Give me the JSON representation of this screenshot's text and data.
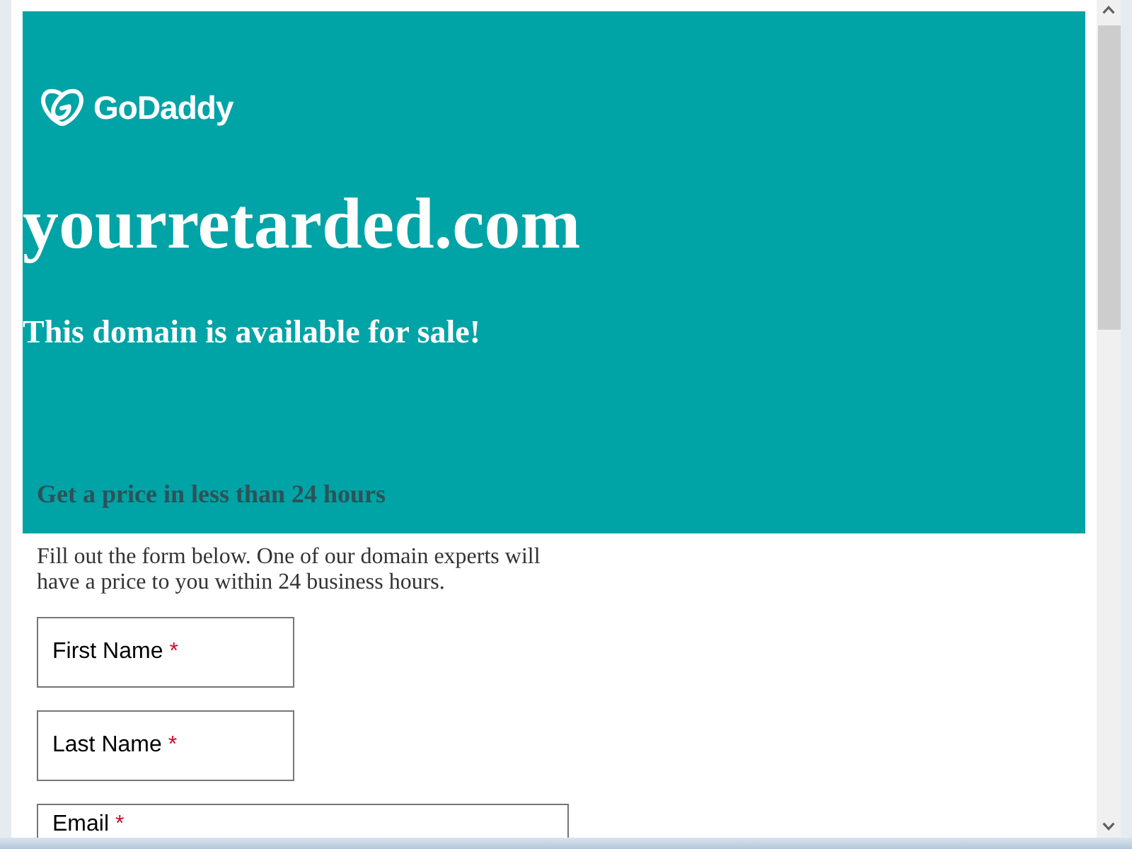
{
  "header": {
    "logo_text": "GoDaddy",
    "domain": "yourretarded.com",
    "tagline": "This domain is available for sale!",
    "subheading": "Get a price in less than 24 hours"
  },
  "form": {
    "intro": "Fill out the form below. One of our domain experts will have a price to you within 24 business hours.",
    "fields": [
      {
        "kind": "short",
        "label": "First Name",
        "required_mark": "*"
      },
      {
        "kind": "short",
        "label": "Last Name",
        "required_mark": "*"
      },
      {
        "kind": "wide",
        "label": "Email",
        "required_mark": "*"
      }
    ]
  }
}
